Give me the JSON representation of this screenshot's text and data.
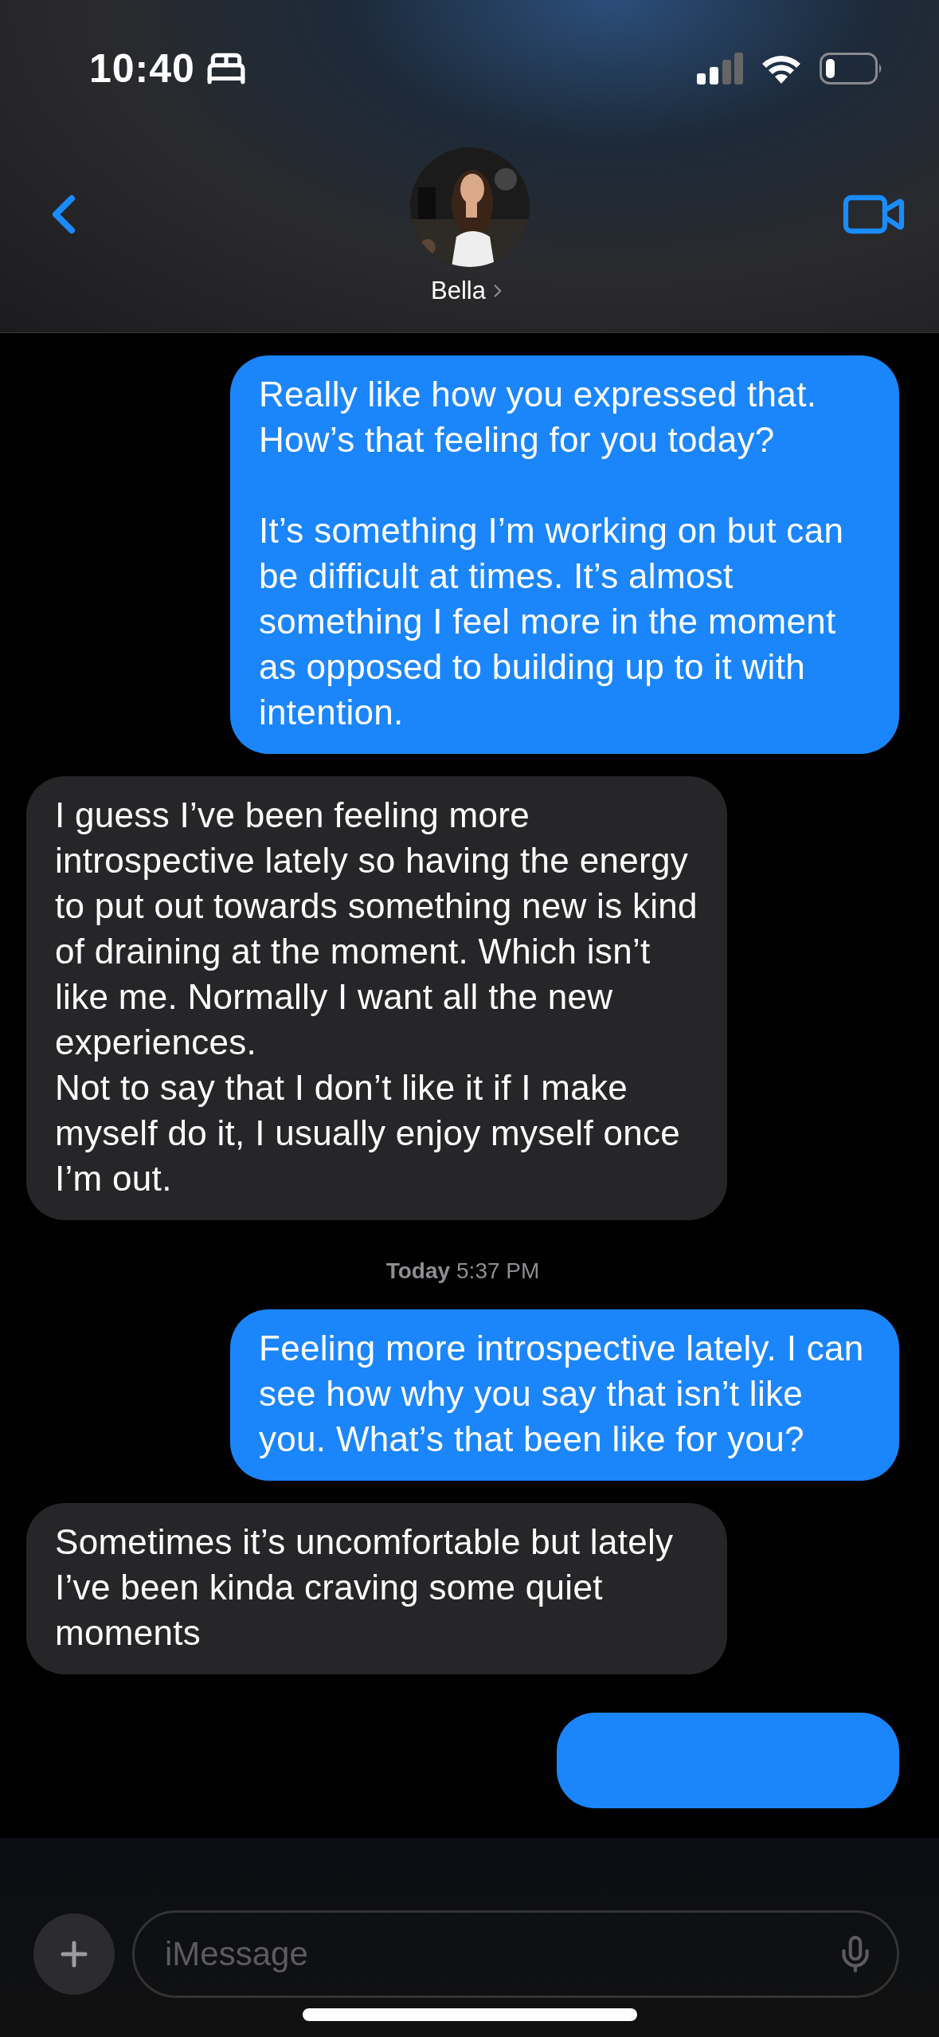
{
  "status_bar": {
    "time": "10:40"
  },
  "header": {
    "contact_name": "Bella"
  },
  "messages": [
    {
      "kind": "outgoing",
      "text": "Really like how you expressed that. How’s that feeling for you today?\n\nIt’s something I’m working on but can be difficult at times. It’s almost something I feel more in the moment as opposed to building up to it with intention."
    },
    {
      "kind": "incoming",
      "text": "I guess I’ve been feeling more introspective lately so having the energy to put out towards something new is kind of draining at the moment. Which isn’t like me. Normally I want all the new experiences.\nNot to say that I don’t like it if I make myself do it, I usually enjoy myself once I’m out."
    },
    {
      "kind": "timestamp",
      "day": "Today",
      "time": "5:37 PM"
    },
    {
      "kind": "outgoing",
      "text": "Feeling more introspective lately. I can see how why you say that isn’t like you. What’s that been like for you?"
    },
    {
      "kind": "incoming",
      "text": "Sometimes it’s uncomfortable but lately I’ve been kinda craving some quiet moments"
    },
    {
      "kind": "outgoing-cut"
    }
  ],
  "composer": {
    "placeholder": "iMessage"
  }
}
